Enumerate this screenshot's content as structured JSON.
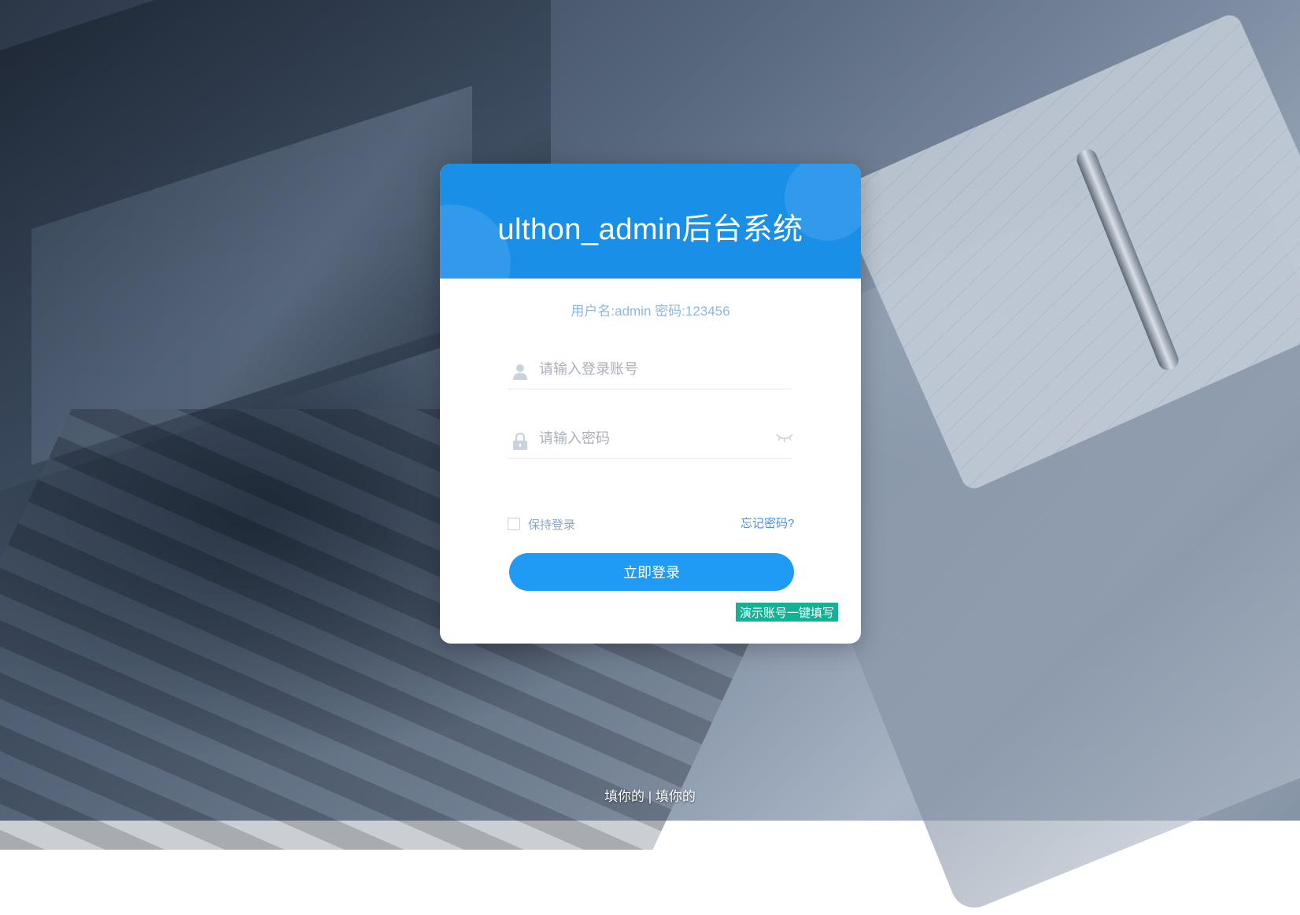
{
  "header": {
    "title": "ulthon_admin后台系统"
  },
  "hint": "用户名:admin 密码:123456",
  "form": {
    "username_placeholder": "请输入登录账号",
    "username_value": "",
    "password_placeholder": "请输入密码",
    "password_value": "",
    "remember_label": "保持登录",
    "forgot_label": "忘记密码?",
    "login_label": "立即登录",
    "demo_fill_label": "演示账号一键填写"
  },
  "footer": {
    "left_link": "填你的",
    "separator": " | ",
    "right_link": "填你的"
  },
  "icons": {
    "user": "user-icon",
    "lock": "lock-icon",
    "eye": "eye-closed-icon"
  },
  "colors": {
    "header_bg": "#1a8fe8",
    "login_button": "#1f9bf5",
    "demo_button": "#14b294",
    "hint_text": "#8db8dc",
    "forgot_link": "#4a90e2"
  }
}
